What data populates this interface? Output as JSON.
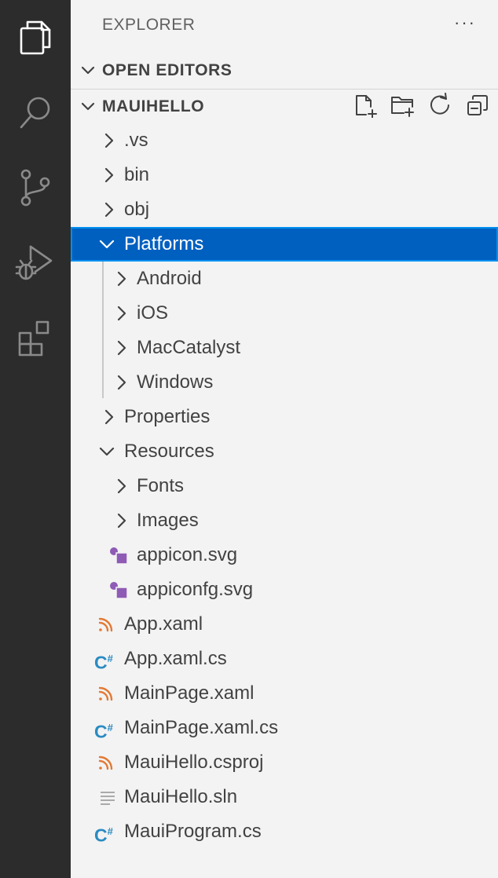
{
  "explorer": {
    "title": "EXPLORER",
    "more": "···"
  },
  "open_editors": {
    "label": "OPEN EDITORS"
  },
  "workspace": {
    "label": "MAUIHELLO"
  },
  "tree": [
    {
      "label": ".vs",
      "kind": "folder",
      "expanded": false
    },
    {
      "label": "bin",
      "kind": "folder",
      "expanded": false
    },
    {
      "label": "obj",
      "kind": "folder",
      "expanded": false
    },
    {
      "label": "Platforms",
      "kind": "folder",
      "expanded": true,
      "selected": true
    },
    {
      "label": "Android",
      "kind": "folder",
      "expanded": false
    },
    {
      "label": "iOS",
      "kind": "folder",
      "expanded": false
    },
    {
      "label": "MacCatalyst",
      "kind": "folder",
      "expanded": false
    },
    {
      "label": "Windows",
      "kind": "folder",
      "expanded": false
    },
    {
      "label": "Properties",
      "kind": "folder",
      "expanded": false
    },
    {
      "label": "Resources",
      "kind": "folder",
      "expanded": true
    },
    {
      "label": "Fonts",
      "kind": "folder",
      "expanded": false
    },
    {
      "label": "Images",
      "kind": "folder",
      "expanded": false
    },
    {
      "label": "appicon.svg",
      "kind": "svg-file"
    },
    {
      "label": "appiconfg.svg",
      "kind": "svg-file"
    },
    {
      "label": "App.xaml",
      "kind": "xml-file"
    },
    {
      "label": "App.xaml.cs",
      "kind": "csharp-file"
    },
    {
      "label": "MainPage.xaml",
      "kind": "xml-file"
    },
    {
      "label": "MainPage.xaml.cs",
      "kind": "csharp-file"
    },
    {
      "label": "MauiHello.csproj",
      "kind": "xml-file"
    },
    {
      "label": "MauiHello.sln",
      "kind": "text-file"
    },
    {
      "label": "MauiProgram.cs",
      "kind": "csharp-file"
    }
  ],
  "icons": {
    "csharp_glyph": "C",
    "csharp_sup": "#"
  },
  "colors": {
    "selection": "#0060c0",
    "activity_bar": "#2c2c2c",
    "sidebar": "#f3f3f3",
    "svg_icon": "#8e5bb5",
    "xml_icon": "#e37933",
    "csharp_icon": "#2a8bc2"
  }
}
